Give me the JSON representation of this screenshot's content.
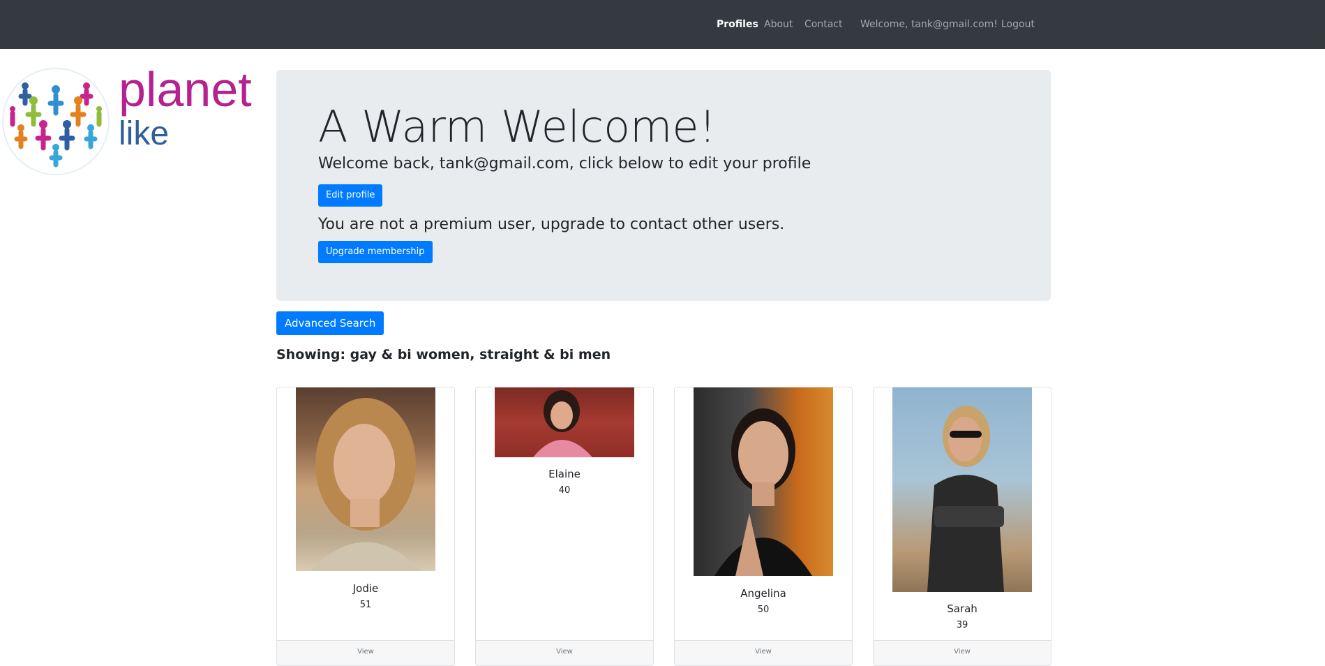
{
  "navbar": {
    "links": [
      "Profiles",
      "About",
      "Contact"
    ],
    "welcome": "Welcome, tank@gmail.com!",
    "logout": "Logout",
    "background": "#343a40"
  },
  "logo": {
    "word1": "planet",
    "word2": "like",
    "color1": "#b5218f",
    "color2": "#2f5f9b"
  },
  "jumbotron": {
    "title": "A Warm Welcome!",
    "welcome_line": "Welcome back, tank@gmail.com, click below to edit your profile",
    "edit_button": "Edit profile",
    "premium_line": "You are not a premium user, upgrade to contact other users.",
    "upgrade_button": "Upgrade membership"
  },
  "search": {
    "button": "Advanced Search",
    "showing": "Showing: gay & bi women, straight & bi men"
  },
  "accent_color": "#007bff",
  "profiles": [
    {
      "name": "Jodie",
      "age": "51",
      "view": "View",
      "photo": "photo-of-jodie"
    },
    {
      "name": "Elaine",
      "age": "40",
      "view": "View",
      "photo": "photo-of-elaine"
    },
    {
      "name": "Angelina",
      "age": "50",
      "view": "View",
      "photo": "photo-of-angelina"
    },
    {
      "name": "Sarah",
      "age": "39",
      "view": "View",
      "photo": "photo-of-sarah"
    }
  ]
}
